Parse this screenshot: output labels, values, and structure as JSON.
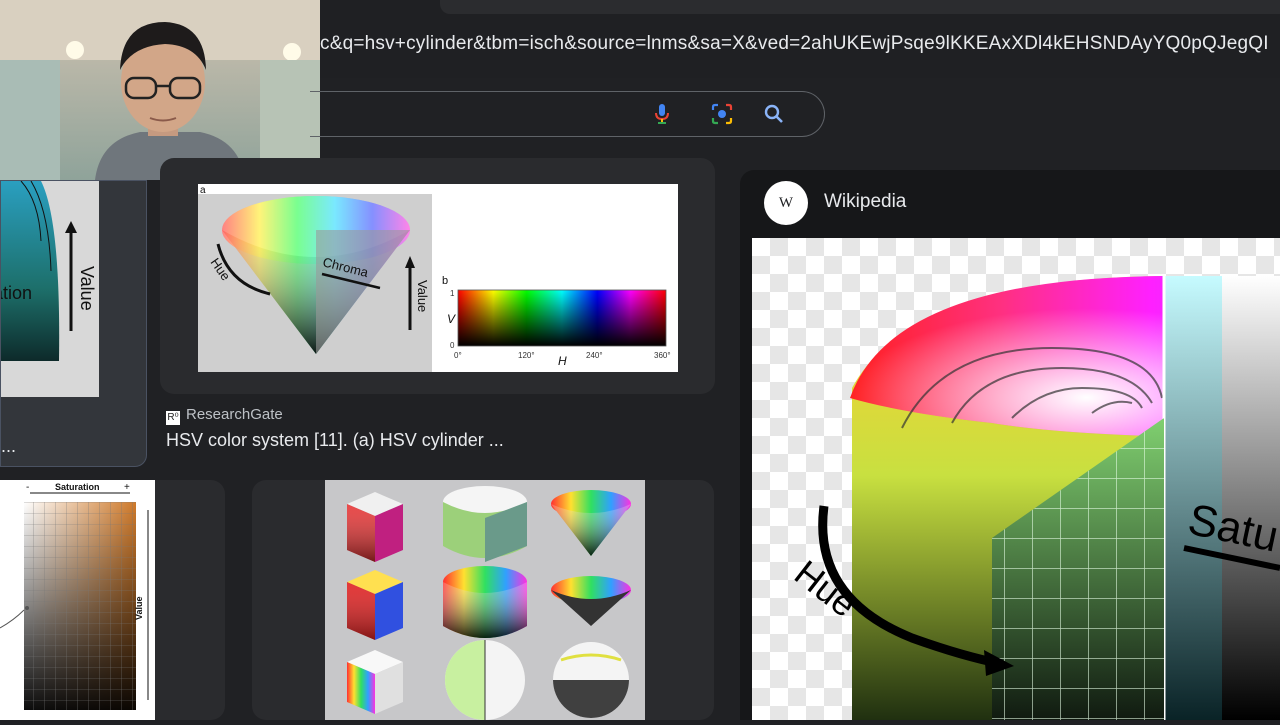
{
  "browser": {
    "url": "c&q=hsv+cylinder&tbm=isch&source=lnms&sa=X&ved=2ahUKEwjPsqe9lKKEAxXDl4kEHSNDAyYQ0pQJegQI",
    "search_icons": [
      "microphone-icon",
      "lens-camera-icon",
      "search-icon"
    ]
  },
  "results": {
    "left_top_caption": "...",
    "left_top_labels": {
      "value": "Value",
      "saturation": "ation"
    },
    "researchgate": {
      "source": "ResearchGate",
      "source_icon": "R⁰",
      "title": "HSV color system [11]. (a) HSV cylinder ...",
      "figure": {
        "panel_a": "a",
        "panel_b": "b",
        "hue": "Hue",
        "chroma": "Chroma",
        "value": "Value",
        "v": "V",
        "h": "H",
        "v_max": "1",
        "v_min": "0",
        "h_ticks": [
          "0°",
          "120°",
          "240°",
          "360°"
        ]
      }
    },
    "saturation_chart": {
      "title": "Saturation",
      "minus": "-",
      "plus": "+",
      "value": "Value"
    }
  },
  "wikipedia": {
    "logo": "W",
    "name": "Wikipedia",
    "labels": {
      "hue": "Hue",
      "saturation": "Satu"
    }
  }
}
